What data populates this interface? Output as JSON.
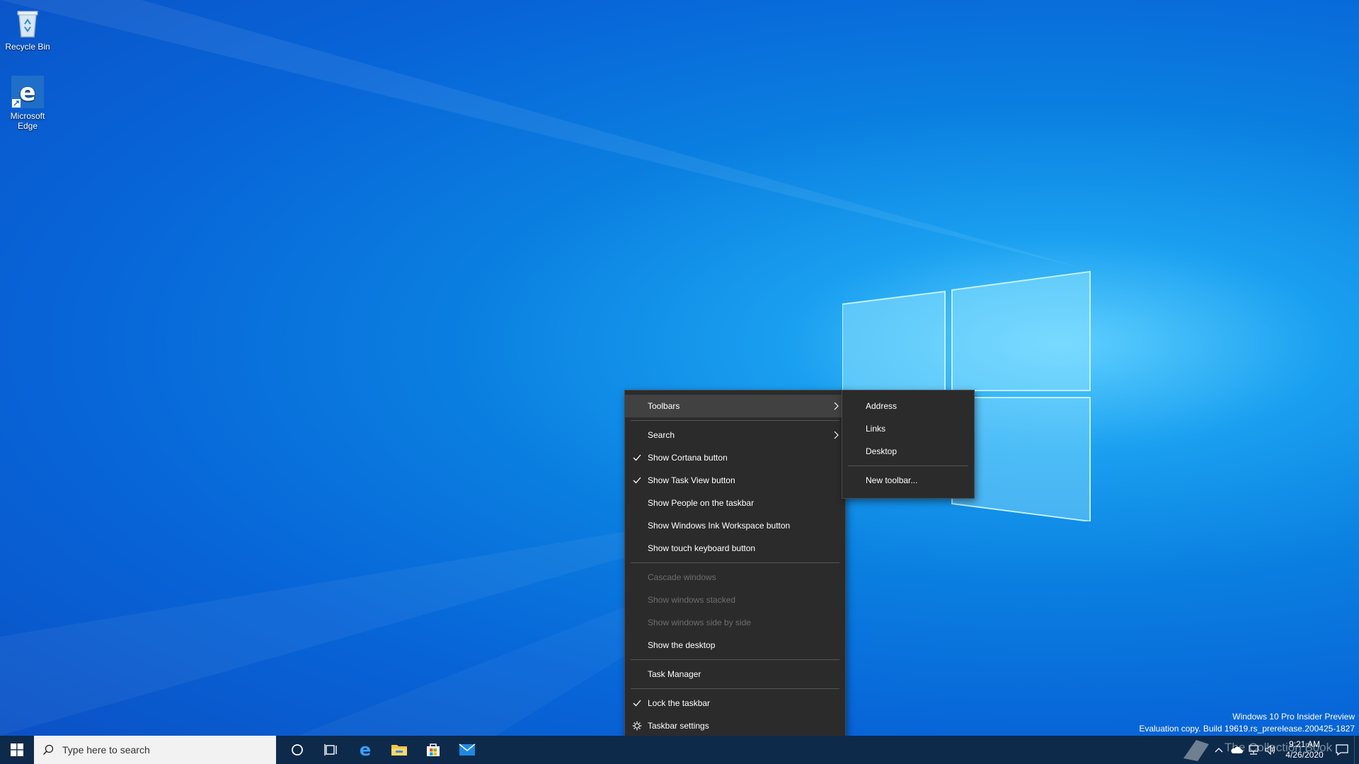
{
  "desktop": {
    "icons": [
      {
        "label": "Recycle Bin",
        "icon": "recycle-bin-icon"
      },
      {
        "label": "Microsoft Edge",
        "icon": "edge-icon"
      }
    ],
    "watermark": {
      "line1": "Windows 10 Pro Insider Preview",
      "line2": "Evaluation copy. Build 19619.rs_prerelease.200425-1827"
    },
    "overlay_text": "The Collection Book"
  },
  "context_menu": {
    "items": [
      {
        "label": "Toolbars",
        "submenu": true,
        "active": true
      },
      {
        "label": "Search",
        "submenu": true
      },
      {
        "label": "Show Cortana button",
        "checked": true
      },
      {
        "label": "Show Task View button",
        "checked": true
      },
      {
        "label": "Show People on the taskbar"
      },
      {
        "label": "Show Windows Ink Workspace button"
      },
      {
        "label": "Show touch keyboard button"
      },
      {
        "label": "Cascade windows",
        "disabled": true
      },
      {
        "label": "Show windows stacked",
        "disabled": true
      },
      {
        "label": "Show windows side by side",
        "disabled": true
      },
      {
        "label": "Show the desktop"
      },
      {
        "label": "Task Manager"
      },
      {
        "label": "Lock the taskbar",
        "checked": true
      },
      {
        "label": "Taskbar settings",
        "icon": "gear-icon"
      }
    ]
  },
  "toolbars_submenu": {
    "items": [
      {
        "label": "Address"
      },
      {
        "label": "Links"
      },
      {
        "label": "Desktop"
      },
      {
        "label": "New toolbar..."
      }
    ]
  },
  "taskbar": {
    "search_placeholder": "Type here to search",
    "pinned": [
      "cortana-icon",
      "task-view-icon",
      "edge-icon",
      "file-explorer-icon",
      "store-icon",
      "mail-icon"
    ],
    "clock": {
      "time": "9:21 AM",
      "date": "4/26/2020"
    },
    "colors": {
      "taskbar": "#0e2a4a",
      "menu": "#2b2b2b"
    }
  }
}
